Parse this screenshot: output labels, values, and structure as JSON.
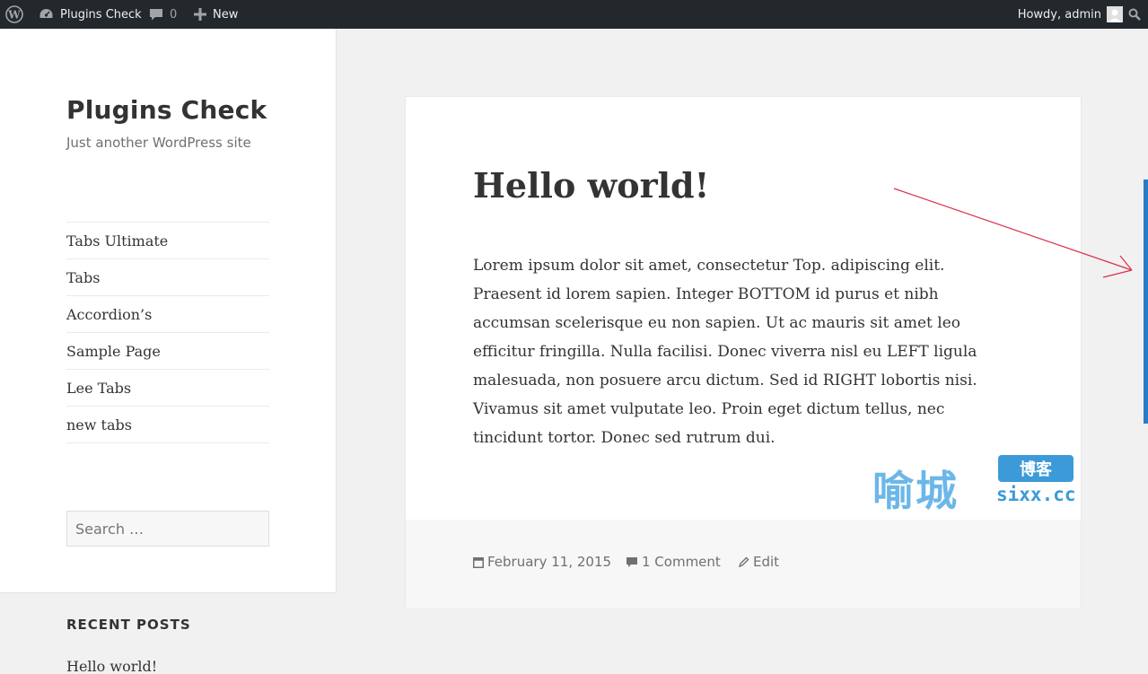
{
  "adminbar": {
    "site_name": "Plugins Check",
    "comment_count": "0",
    "new_label": "New",
    "howdy": "Howdy, admin"
  },
  "site": {
    "title": "Plugins Check",
    "description": "Just another WordPress site"
  },
  "menu": {
    "items": [
      "Tabs Ultimate",
      "Tabs",
      "Accordion’s",
      "Sample Page",
      "Lee Tabs",
      "new tabs"
    ]
  },
  "search": {
    "placeholder": "Search …"
  },
  "recent_posts": {
    "heading": "RECENT POSTS",
    "items": [
      "Hello world!"
    ]
  },
  "post": {
    "title": "Hello world!",
    "body": "Lorem ipsum dolor sit amet, consectetur Top. adipiscing elit. Praesent id lorem sapien. Integer BOTTOM id purus et nibh accumsan scelerisque eu non sapien. Ut ac mauris sit amet leo efficitur fringilla. Nulla facilisi. Donec viverra nisl eu LEFT ligula malesuada, non posuere arcu dictum. Sed id RIGHT lobortis nisi. Vivamus sit amet vulputate leo. Proin eget dictum tellus, nec tincidunt tortor. Donec sed rutrum dui.",
    "date": "February 11, 2015",
    "comments": "1 Comment",
    "edit": "Edit"
  },
  "watermark": {
    "chinese": "喻城",
    "badge": "博客",
    "domain": "sixx.cc"
  },
  "colors": {
    "adminbar_bg": "#23282d",
    "scroll_accent": "#2a7cc7",
    "arrow": "#d9304b"
  }
}
